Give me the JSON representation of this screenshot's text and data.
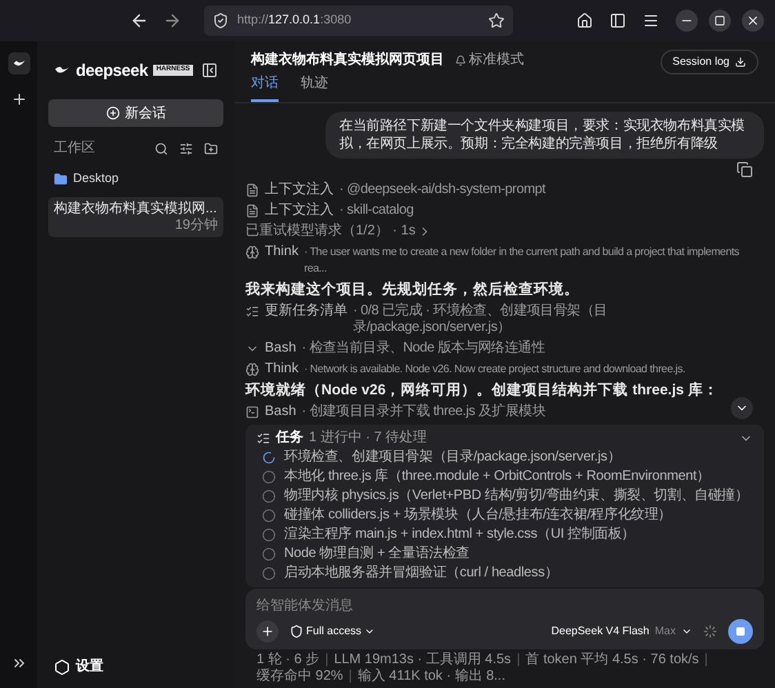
{
  "browser": {
    "url_prefix": "http://",
    "url_host": "127.0.0.1",
    "url_port": ":3080"
  },
  "sidebar": {
    "brand": "deepseek",
    "badge": "HARNESS",
    "new_chat": "新会话",
    "workspace_label": "工作区",
    "folder": "Desktop",
    "sessions": [
      {
        "title": "构建衣物布料真实模拟网...",
        "time": "19分钟",
        "selected": true
      }
    ],
    "settings": "设置"
  },
  "header": {
    "title": "构建衣物布料真实模拟网页项目",
    "mode": "标准模式",
    "session_log": "Session log",
    "tabs": [
      {
        "label": "对话",
        "selected": true
      },
      {
        "label": "轨迹",
        "selected": false
      }
    ]
  },
  "messages": [
    {
      "kind": "user",
      "text": "在当前路径下新建一个文件夹构建项目，要求：实现衣物布料真实模拟，在网页上展示。预期：完全构建的完善项目，拒绝所有降级"
    },
    {
      "kind": "context",
      "label": "上下文注入",
      "detail": "· @deepseek-ai/dsh-system-prompt"
    },
    {
      "kind": "context",
      "label": "上下文注入",
      "detail": "· skill-catalog"
    },
    {
      "kind": "retry",
      "text": "已重试模型请求（1/2） · 1s"
    },
    {
      "kind": "think",
      "label": "Think",
      "detail": "· The user wants me to create a new folder in the current path and build a project that implements rea..."
    },
    {
      "kind": "reply",
      "text": "我来构建这个项目。先规划任务，然后检查环境。"
    },
    {
      "kind": "todo",
      "label": "更新任务清单",
      "detail": "· 0/8 已完成 · 环境检查、创建项目骨架（目录/package.json/server.js）"
    },
    {
      "kind": "bash_expanded",
      "label": "Bash",
      "detail": "· 检查当前目录、Node 版本与网络连通性"
    },
    {
      "kind": "think",
      "label": "Think",
      "detail": "· Network is available. Node v26. Now create project structure and download three.js."
    },
    {
      "kind": "reply",
      "text": "环境就绪（Node v26，网络可用）。创建项目结构并下载 three.js 库："
    },
    {
      "kind": "bash",
      "label": "Bash",
      "detail": "· 创建项目目录并下载 three.js 及扩展模块"
    }
  ],
  "tasks": {
    "title": "任务",
    "summary": "1 进行中 · 7 待处理",
    "items": [
      {
        "text": "环境检查、创建项目骨架（目录/package.json/server.js）",
        "kind": "running"
      },
      {
        "text": "本地化 three.js 库（three.module + OrbitControls + RoomEnvironment）",
        "kind": "pending"
      },
      {
        "text": "物理内核 physics.js（Verlet+PBD 结构/剪切/弯曲约束、撕裂、切割、自碰撞）",
        "kind": "pending"
      },
      {
        "text": "碰撞体 colliders.js + 场景模块（人台/悬挂布/连衣裙/程序化纹理）",
        "kind": "pending"
      },
      {
        "text": "渲染主程序 main.js + index.html + style.css（UI 控制面板）",
        "kind": "pending"
      },
      {
        "text": "Node 物理自测 + 全量语法检查",
        "kind": "pending"
      },
      {
        "text": "启动本地服务器并冒烟验证（curl / headless）",
        "kind": "pending"
      }
    ]
  },
  "composer": {
    "placeholder": "给智能体发消息",
    "access": "Full access",
    "model": "DeepSeek V4 Flash",
    "effort": "Max"
  },
  "status_separator": "|",
  "status_bar": [
    "1 轮 · 6 步",
    "LLM 19m13s · 工具调用 4.5s",
    "首 token 平均 4.5s · 76 tok/s",
    "缓存命中 92%",
    "输入 411K tok · 输出 8..."
  ]
}
